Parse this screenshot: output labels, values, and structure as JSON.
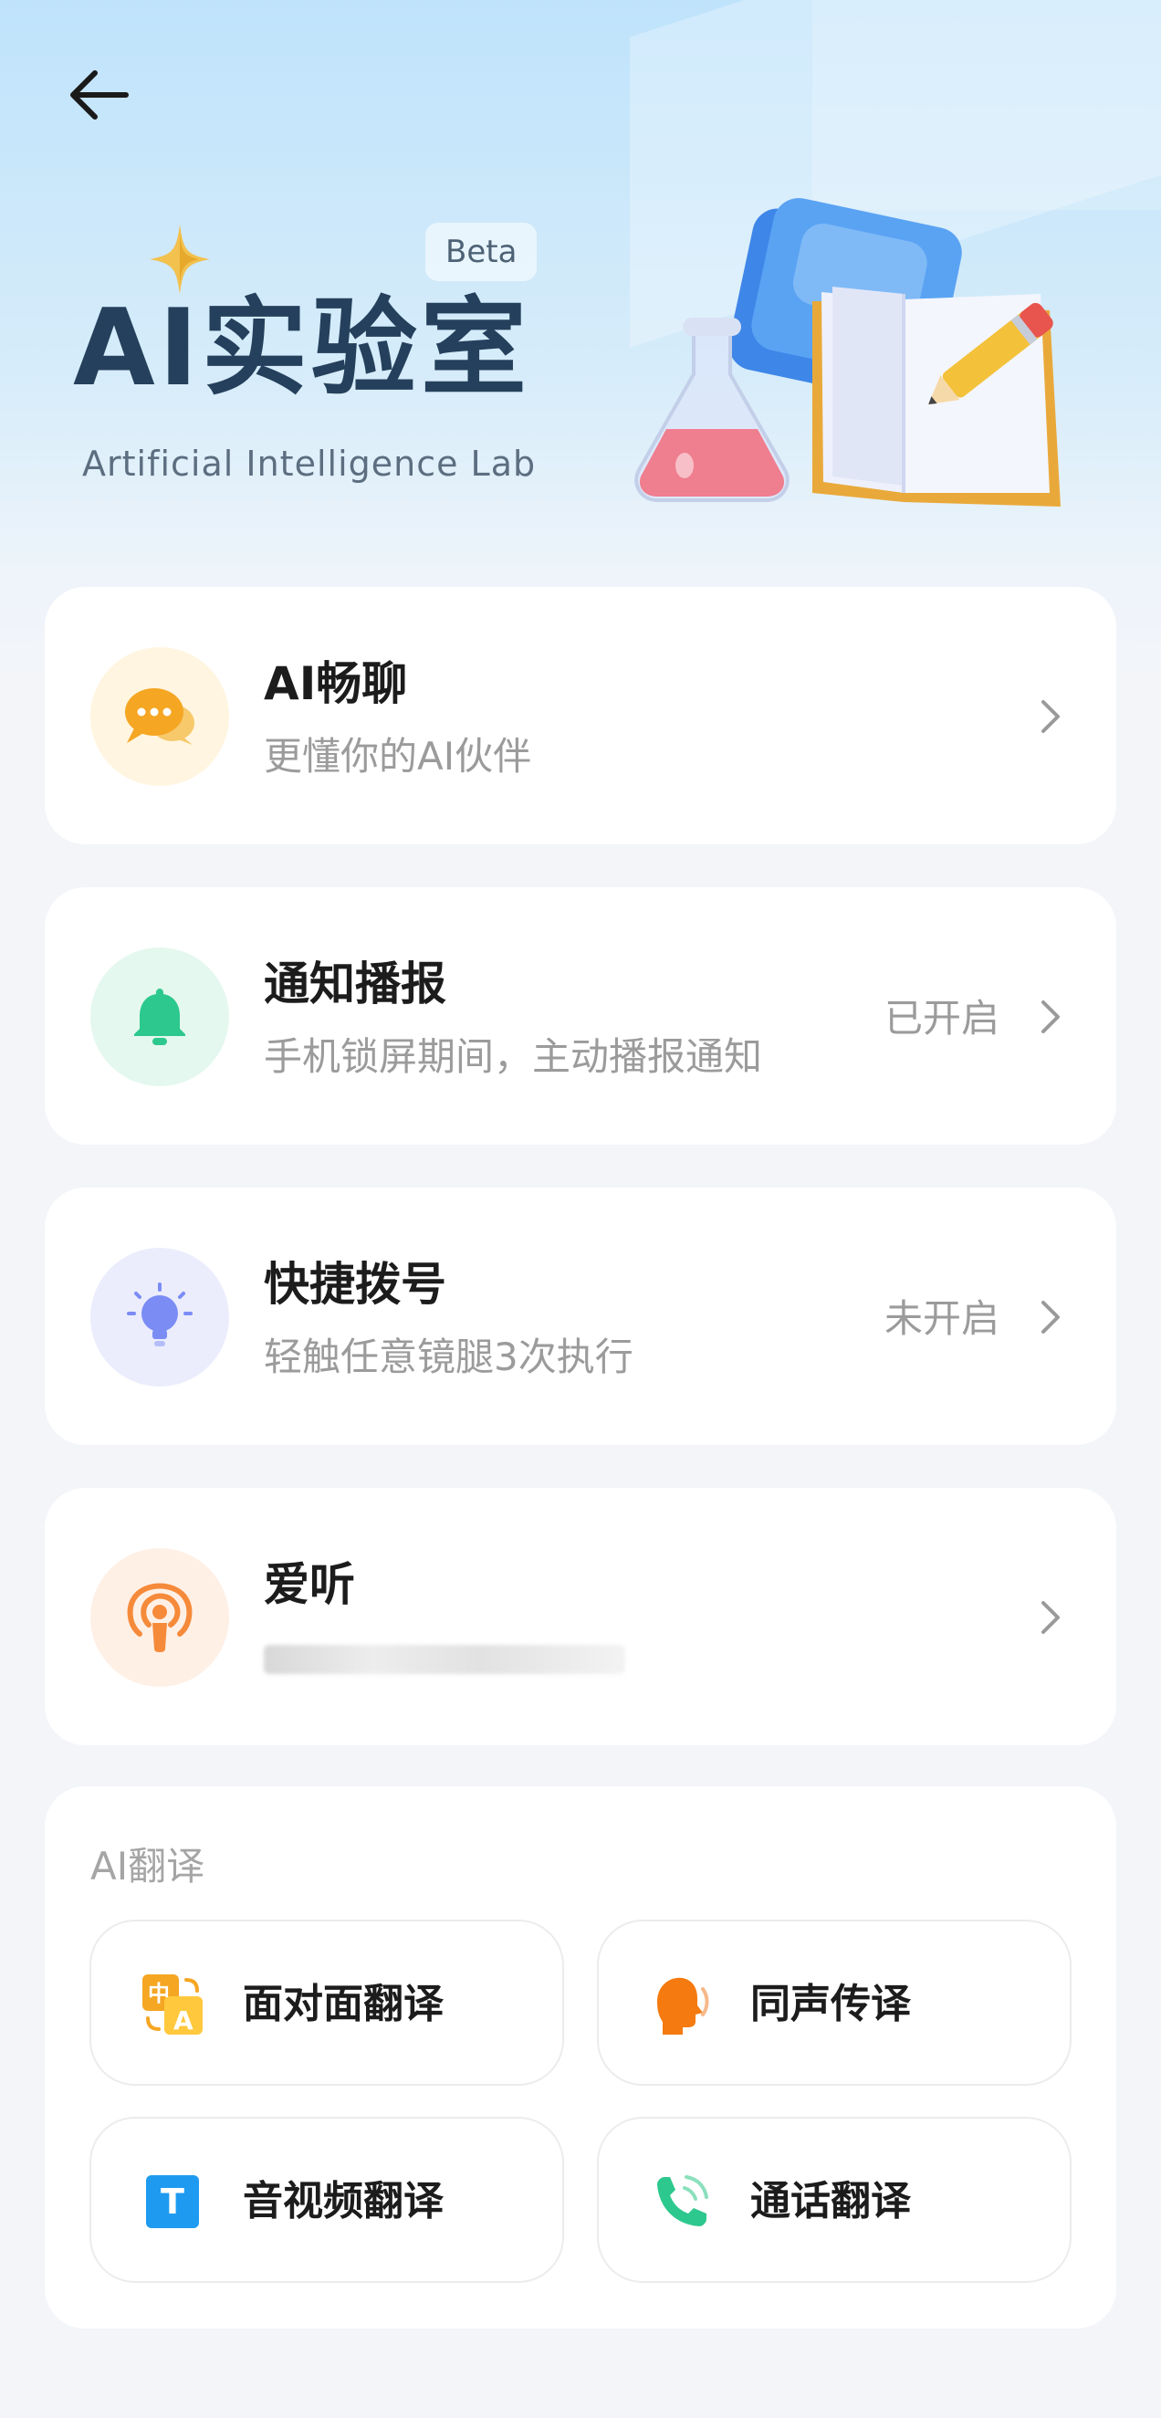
{
  "header": {
    "back_icon": "back-arrow-icon",
    "beta_badge": "Beta",
    "title": "AI实验室",
    "subtitle": "Artificial Intelligence Lab",
    "sparkle_icon": "sparkle-icon",
    "illustration": "flask-book-pencil-illustration"
  },
  "features": [
    {
      "title": "AI畅聊",
      "subtitle": "更懂你的AI伙伴",
      "status": "",
      "icon": "chat-bubble-icon",
      "accent": "#f5b52a",
      "bg": "#fff5e0"
    },
    {
      "title": "通知播报",
      "subtitle": "手机锁屏期间，主动播报通知",
      "status": "已开启",
      "icon": "bell-icon",
      "accent": "#2dc88d",
      "bg": "#e4f8ef"
    },
    {
      "title": "快捷拨号",
      "subtitle": "轻触任意镜腿3次执行",
      "status": "未开启",
      "icon": "lightbulb-icon",
      "accent": "#7b8cf5",
      "bg": "#ebedfd"
    },
    {
      "title": "爱听",
      "subtitle": "",
      "status": "",
      "icon": "podcast-icon",
      "accent": "#f58a3a",
      "bg": "#fff0e6"
    }
  ],
  "translation": {
    "section_label": "AI翻译",
    "buttons": [
      {
        "label": "面对面翻译",
        "icon": "face-to-face-translate-icon",
        "icon_glyph_top": "中",
        "icon_glyph_bottom": "A"
      },
      {
        "label": "同声传译",
        "icon": "simultaneous-interpret-icon"
      },
      {
        "label": "音视频翻译",
        "icon": "text-T-icon",
        "icon_glyph": "T"
      },
      {
        "label": "通话翻译",
        "icon": "phone-call-icon"
      }
    ]
  },
  "colors": {
    "title": "#25405c",
    "page_bg": "#f3f5f9",
    "orange": "#f5a623",
    "blue": "#1e9bf0",
    "green": "#2dc88d"
  }
}
